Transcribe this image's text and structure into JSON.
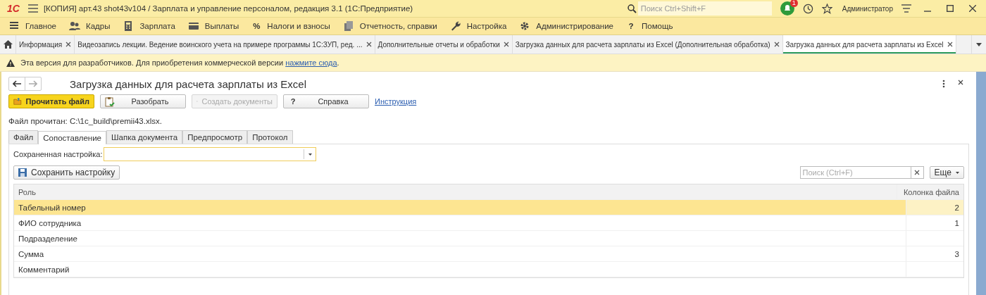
{
  "window": {
    "logo": "1С",
    "title": "[КОПИЯ] арт.43 shot43v104 / Зарплата и управление персоналом, редакция 3.1  (1С:Предприятие)",
    "search_placeholder": "Поиск Ctrl+Shift+F",
    "notifications": "1",
    "user": "Администратор"
  },
  "menu": [
    {
      "label": "Главное"
    },
    {
      "label": "Кадры"
    },
    {
      "label": "Зарплата"
    },
    {
      "label": "Выплаты"
    },
    {
      "label": "Налоги и взносы",
      "glyph": "%"
    },
    {
      "label": "Отчетность, справки"
    },
    {
      "label": "Настройка"
    },
    {
      "label": "Администрирование"
    },
    {
      "label": "Помощь",
      "glyph": "?"
    }
  ],
  "open_tabs": [
    {
      "label": "Информация",
      "selected": false
    },
    {
      "label": "Видеозапись лекции. Ведение воинского учета на примере программы 1С:ЗУП, ред. ...",
      "selected": false
    },
    {
      "label": "Дополнительные отчеты и обработки",
      "selected": false
    },
    {
      "label": "Загрузка данных для расчета зарплаты из Excel (Дополнительная обработка)",
      "selected": false
    },
    {
      "label": "Загрузка данных для расчета зарплаты из Excel",
      "selected": true
    }
  ],
  "warning": {
    "text": "Эта версия для разработчиков. Для приобретения коммерческой версии ",
    "link": "нажмите сюда",
    "after": "."
  },
  "form": {
    "title": "Загрузка данных для расчета зарплаты из Excel",
    "buttons": [
      {
        "label": "Прочитать файл",
        "kind": "primary",
        "disabled": false
      },
      {
        "label": "Разобрать",
        "kind": "parse",
        "disabled": false
      },
      {
        "label": "Создать документы",
        "kind": "create",
        "disabled": true
      },
      {
        "label": "Справка",
        "kind": "help",
        "glyph": "?",
        "disabled": false
      }
    ],
    "link": "Инструкция",
    "status": "Файл прочитан: C:\\1c_build\\premii43.xlsx.",
    "tabs": [
      {
        "label": "Файл",
        "selected": false
      },
      {
        "label": "Сопоставление",
        "selected": true
      },
      {
        "label": "Шапка документа",
        "selected": false
      },
      {
        "label": "Предпросмотр",
        "selected": false
      },
      {
        "label": "Протокол",
        "selected": false
      }
    ],
    "saved_setting_label": "Сохраненная настройка:",
    "save_button": "Сохранить настройку",
    "search_placeholder": "Поиск (Ctrl+F)",
    "more_button": "Еще",
    "table": {
      "columns": [
        "Роль",
        "Колонка файла"
      ],
      "rows": [
        {
          "role": "Табельный номер",
          "column": "2",
          "selected": true
        },
        {
          "role": "ФИО сотрудника",
          "column": "1",
          "selected": false
        },
        {
          "role": "Подразделение",
          "selected": false
        },
        {
          "role": "Сумма",
          "column": "3",
          "selected": false
        },
        {
          "role": "Комментарий",
          "selected": false
        }
      ]
    }
  }
}
